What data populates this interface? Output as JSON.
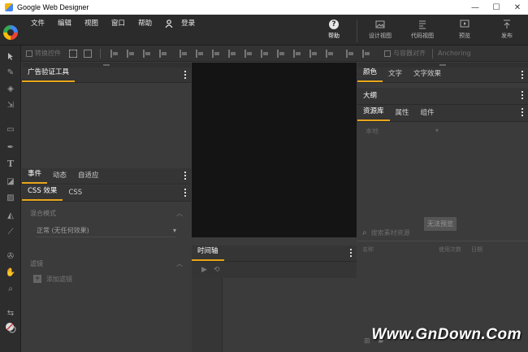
{
  "window": {
    "title": "Google Web Designer",
    "minimize": "—",
    "maximize": "☐",
    "close": "✕"
  },
  "menu": {
    "file": "文件",
    "edit": "编辑",
    "view": "视图",
    "window": "窗口",
    "help": "帮助",
    "login": "登录"
  },
  "top_actions": {
    "help": "帮助",
    "design_view": "设计视图",
    "code_view": "代码视图",
    "preview": "预览",
    "publish": "发布"
  },
  "toolbar": {
    "transform_label": "转换控件",
    "align_container_label": "与容器对齐",
    "anchoring_label": "Anchoring"
  },
  "left_panel": {
    "tab_ad_validator": "广告验证工具",
    "tab_events": "事件",
    "tab_animation": "动态",
    "tab_responsive": "自适应",
    "tab_css_effects": "CSS 效果",
    "tab_css": "CSS",
    "blend_mode_label": "混合模式",
    "blend_mode_value": "正常 (无任何效果)",
    "filter_label": "滤镜",
    "add_filter_label": "添加滤镜"
  },
  "timeline": {
    "tab_label": "时间轴"
  },
  "right_panel": {
    "tab_color": "颜色",
    "tab_text": "文字",
    "tab_text_effects": "文字效果",
    "outline_label": "大纲",
    "tab_library": "资源库",
    "tab_properties": "属性",
    "tab_components": "组件",
    "local_select": "本地",
    "no_preview": "无法预览",
    "search_placeholder": "搜索素材资源",
    "col_name": "名称",
    "col_usage": "使用次数",
    "col_date": "日期"
  },
  "watermark": "Www.GnDown.Com",
  "colors": {
    "accent": "#e9a61b",
    "stage": "#141414",
    "panel": "#3b3b3b",
    "topbar": "#2b2b2b"
  }
}
